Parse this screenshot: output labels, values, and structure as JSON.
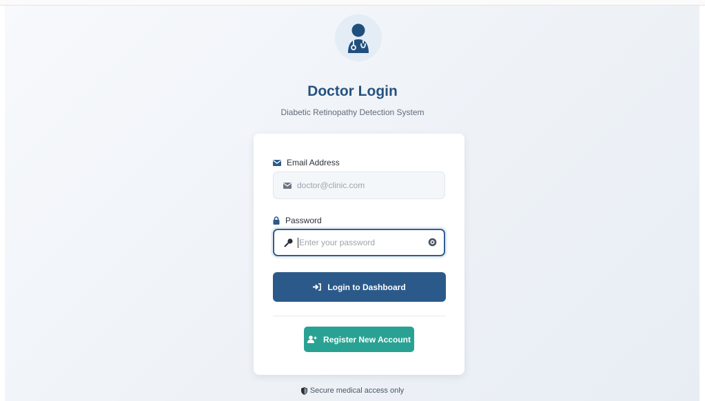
{
  "colors": {
    "brand": "#27527f",
    "login_button": "#2b5a8a",
    "register_button": "#2aa293",
    "background": "#eef2f7"
  },
  "header": {
    "avatar_icon": "doctor-avatar-icon",
    "title": "Doctor Login",
    "subtitle": "Diabetic Retinopathy Detection System"
  },
  "form": {
    "email": {
      "label": "Email Address",
      "label_icon": "envelope-icon",
      "placeholder": "doctor@clinic.com",
      "value": ""
    },
    "password": {
      "label": "Password",
      "label_icon": "lock-icon",
      "field_icon": "key-icon",
      "toggle_icon": "eye-icon",
      "placeholder": "Enter your password",
      "value": ""
    },
    "login_button": {
      "label": "Login to Dashboard",
      "icon": "sign-in-icon"
    },
    "register_button": {
      "label": "Register New Account",
      "icon": "user-plus-icon"
    }
  },
  "footer": {
    "icon": "shield-icon",
    "text": "Secure medical access only"
  }
}
